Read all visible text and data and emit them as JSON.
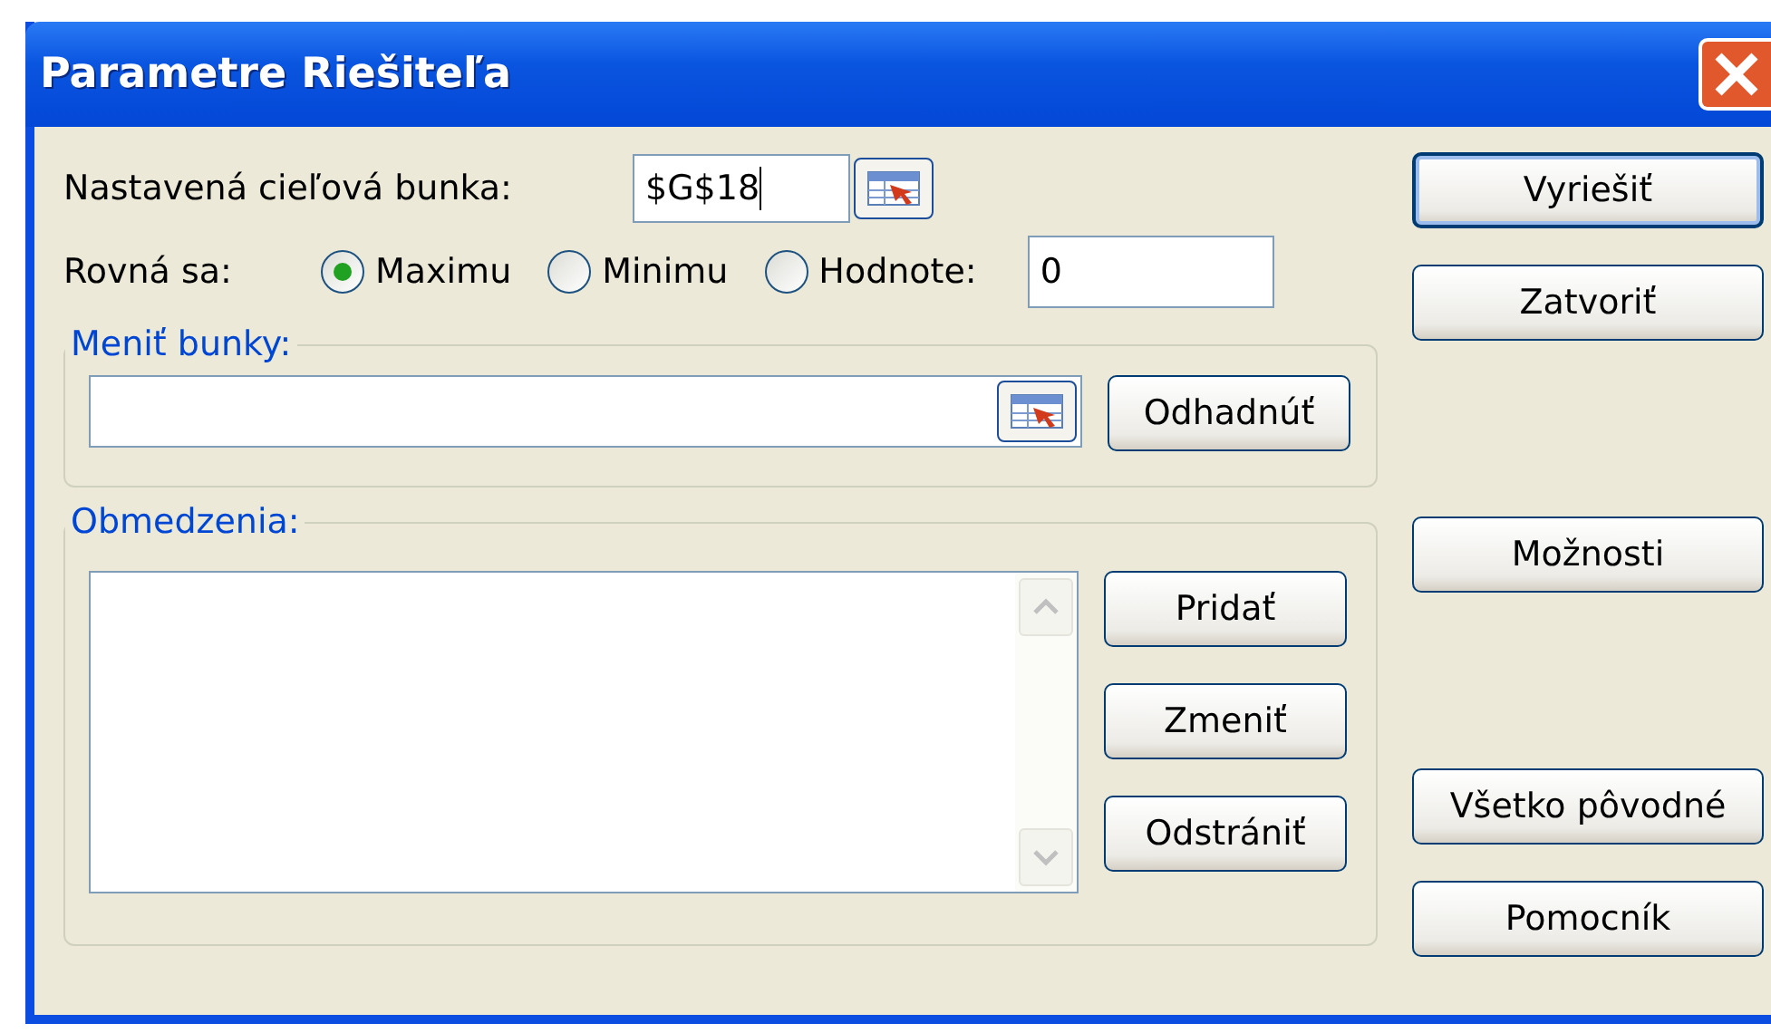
{
  "window": {
    "title": "Parametre Riešiteľa"
  },
  "target": {
    "label": "Nastavená cieľová bunka:",
    "value": "$G$18"
  },
  "equal_to": {
    "label": "Rovná sa:",
    "options": [
      {
        "label": "Maximu",
        "selected": true
      },
      {
        "label": "Minimu",
        "selected": false
      },
      {
        "label": "Hodnote:",
        "selected": false
      }
    ],
    "value": "0"
  },
  "changing_cells": {
    "title": "Meniť bunky:",
    "button": "Odhadnúť"
  },
  "constraints": {
    "title": "Obmedzenia:",
    "buttons": [
      "Pridať",
      "Zmeniť",
      "Odstrániť"
    ]
  },
  "side_button_groups": [
    [
      {
        "label": "Vyriešiť",
        "default": true
      },
      {
        "label": "Zatvoriť",
        "default": false
      }
    ],
    [
      {
        "label": "Možnosti",
        "default": false
      }
    ],
    [
      {
        "label": "Všetko pôvodné",
        "default": false
      },
      {
        "label": "Pomocník",
        "default": false
      }
    ]
  ]
}
